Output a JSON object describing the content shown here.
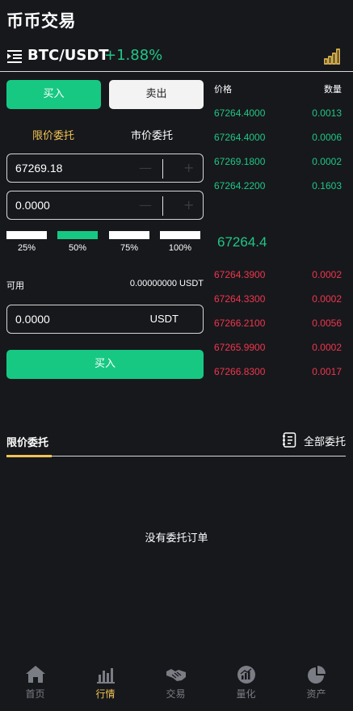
{
  "header": {
    "title": "币币交易"
  },
  "pair": {
    "name": "BTC/USDT",
    "change": "+1.88%"
  },
  "trade": {
    "buy_tab": "买入",
    "sell_tab": "卖出",
    "order_types": {
      "limit": "限价委托",
      "market": "市价委托"
    },
    "price_value": "67269.18",
    "amount_value": "0.0000",
    "stepper_minus": "—",
    "stepper_plus": "+",
    "percents": [
      "25%",
      "50%",
      "75%",
      "100%"
    ],
    "active_percent_index": 1,
    "available_label": "可用",
    "available_value": "0.00000000 USDT",
    "total_value": "0.0000",
    "total_unit": "USDT",
    "submit_label": "买入"
  },
  "orderbook": {
    "price_header": "价格",
    "qty_header": "数量",
    "bids": [
      {
        "price": "67264.4000",
        "qty": "0.0013"
      },
      {
        "price": "67264.4000",
        "qty": "0.0006"
      },
      {
        "price": "67269.1800",
        "qty": "0.0002"
      },
      {
        "price": "67264.2200",
        "qty": "0.1603"
      }
    ],
    "last_price": "67264.4",
    "asks": [
      {
        "price": "67264.3900",
        "qty": "0.0002"
      },
      {
        "price": "67264.3300",
        "qty": "0.0002"
      },
      {
        "price": "67266.2100",
        "qty": "0.0056"
      },
      {
        "price": "67265.9900",
        "qty": "0.0002"
      },
      {
        "price": "67266.8300",
        "qty": "0.0017"
      }
    ]
  },
  "orders": {
    "tab_label": "限价委托",
    "all_label": "全部委托",
    "empty_message": "没有委托订单"
  },
  "nav": {
    "items": [
      {
        "label": "首页",
        "icon": "home-icon"
      },
      {
        "label": "行情",
        "icon": "market-chart-icon"
      },
      {
        "label": "交易",
        "icon": "handshake-icon"
      },
      {
        "label": "量化",
        "icon": "quant-icon"
      },
      {
        "label": "资产",
        "icon": "pie-chart-icon"
      }
    ],
    "active_index": 1
  },
  "colors": {
    "background": "#17181c",
    "buy_green": "#17c882",
    "sell_red": "#f0364d",
    "accent_yellow": "#f0c453"
  }
}
